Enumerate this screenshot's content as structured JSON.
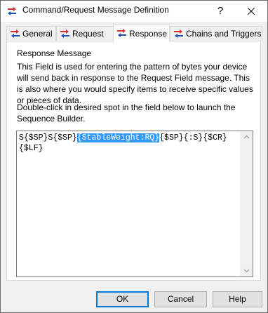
{
  "window": {
    "title": "Command/Request Message Definition",
    "help_glyph": "?",
    "close_icon": "close-icon",
    "app_icon": "exchange-arrows-icon"
  },
  "tabs": [
    {
      "label": "General",
      "icon": "exchange-arrows-icon",
      "active": false
    },
    {
      "label": "Request",
      "icon": "exchange-arrows-icon",
      "active": false
    },
    {
      "label": "Response",
      "icon": "exchange-arrows-icon",
      "active": true
    },
    {
      "label": "Chains and Triggers",
      "icon": "exchange-arrows-icon",
      "active": false
    }
  ],
  "panel": {
    "group_label": "Response Message",
    "description": "This Field is used for entering the pattern of bytes your device will send back in response to the Request Field message.  This is also where you would specify items to receive specific values or pieces of data.",
    "hint": "Double-click in desired spot in the field below to launch the Sequence Builder."
  },
  "editor": {
    "before_selection": "S{$SP}S{$SP}",
    "selection": "{StableWeight:RQ}",
    "after_selection": "{$SP}{:S}{$CR}{$LF}"
  },
  "buttons": {
    "ok": "OK",
    "cancel": "Cancel",
    "help": "Help"
  },
  "colors": {
    "selection_bg": "#3399ff",
    "icon_red": "#d32f2f",
    "icon_blue": "#1f4fb5",
    "default_button_border": "#0078d7"
  }
}
